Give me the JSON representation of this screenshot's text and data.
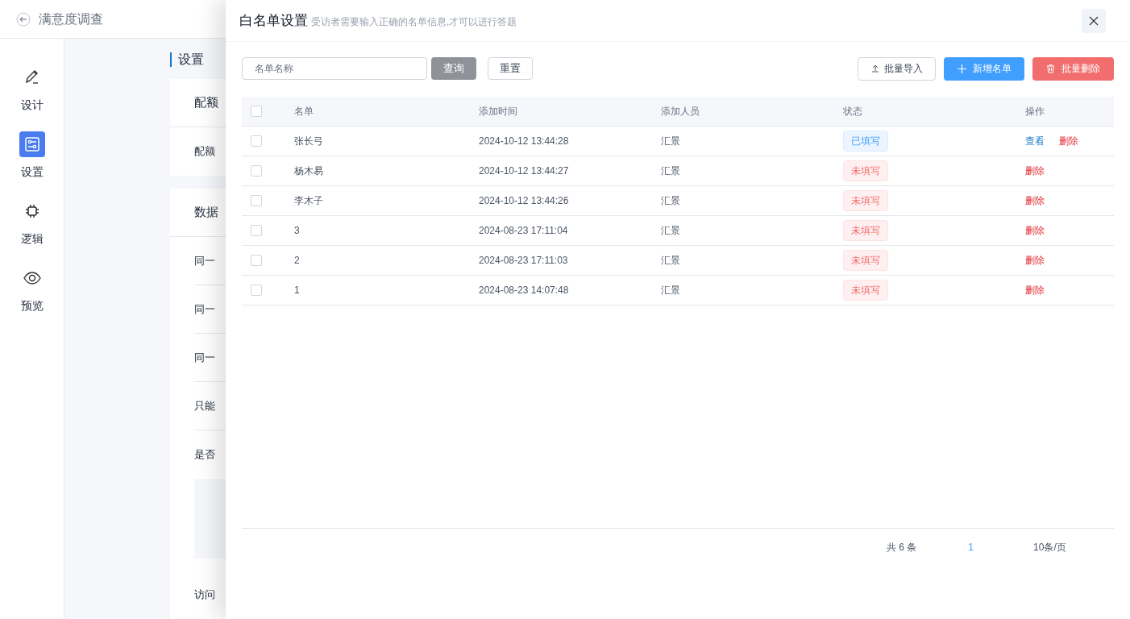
{
  "app": {
    "title": "满意度调查"
  },
  "nav": [
    {
      "label": "设计",
      "kind": "design",
      "selected": false
    },
    {
      "label": "设置",
      "kind": "settings",
      "selected": true
    },
    {
      "label": "逻辑",
      "kind": "logic",
      "selected": false
    },
    {
      "label": "预览",
      "kind": "preview",
      "selected": false
    }
  ],
  "settings": {
    "heading": "设置",
    "cards": [
      {
        "items": [
          {
            "kind": "title",
            "text": "配额"
          },
          {
            "kind": "row",
            "text": "配额"
          }
        ]
      },
      {
        "items": [
          {
            "kind": "title",
            "text": "数据"
          },
          {
            "kind": "row",
            "text": "同一"
          },
          {
            "kind": "row",
            "text": "同一"
          },
          {
            "kind": "row",
            "text": "同一"
          },
          {
            "kind": "row",
            "text": "只能"
          },
          {
            "kind": "row",
            "text": "是否"
          },
          {
            "kind": "panel"
          },
          {
            "kind": "row",
            "text": "访问"
          }
        ]
      }
    ]
  },
  "drawer": {
    "title": "白名单设置",
    "subtitle": "受访者需要输入正确的名单信息,才可以进行答题",
    "search": {
      "placeholder": "名单名称"
    },
    "query_button": "查询",
    "reset_button": "重置",
    "import_button": "批量导入",
    "add_button": "新增名单",
    "bulk_delete_button": "批量删除",
    "table": {
      "select_all": {
        "checked": false
      },
      "columns": [
        "名单",
        "添加时间",
        "添加人员",
        "状态",
        "操作"
      ],
      "rows": [
        {
          "checked": false,
          "name": "张长弓",
          "time": "2024-10-12 13:44:28",
          "by": "汇景",
          "status": {
            "label": "已填写",
            "kind": "filled"
          },
          "actions": [
            {
              "label": "查看",
              "kind": "view"
            },
            {
              "label": "删除",
              "kind": "delete"
            }
          ]
        },
        {
          "checked": false,
          "name": "杨木易",
          "time": "2024-10-12 13:44:27",
          "by": "汇景",
          "status": {
            "label": "未填写",
            "kind": "unfilled"
          },
          "actions": [
            {
              "label": "删除",
              "kind": "delete"
            }
          ]
        },
        {
          "checked": false,
          "name": "李木子",
          "time": "2024-10-12 13:44:26",
          "by": "汇景",
          "status": {
            "label": "未填写",
            "kind": "unfilled"
          },
          "actions": [
            {
              "label": "删除",
              "kind": "delete"
            }
          ]
        },
        {
          "checked": false,
          "name": "3",
          "time": "2024-08-23 17:11:04",
          "by": "汇景",
          "status": {
            "label": "未填写",
            "kind": "unfilled"
          },
          "actions": [
            {
              "label": "删除",
              "kind": "delete"
            }
          ]
        },
        {
          "checked": false,
          "name": "2",
          "time": "2024-08-23 17:11:03",
          "by": "汇景",
          "status": {
            "label": "未填写",
            "kind": "unfilled"
          },
          "actions": [
            {
              "label": "删除",
              "kind": "delete"
            }
          ]
        },
        {
          "checked": false,
          "name": "1",
          "time": "2024-08-23 14:07:48",
          "by": "汇景",
          "status": {
            "label": "未填写",
            "kind": "unfilled"
          },
          "actions": [
            {
              "label": "删除",
              "kind": "delete"
            }
          ]
        }
      ]
    },
    "pagination": {
      "total": "共 6 条",
      "pages": [
        {
          "label": "1",
          "selected": true
        }
      ],
      "page_size": "10条/页"
    }
  }
}
